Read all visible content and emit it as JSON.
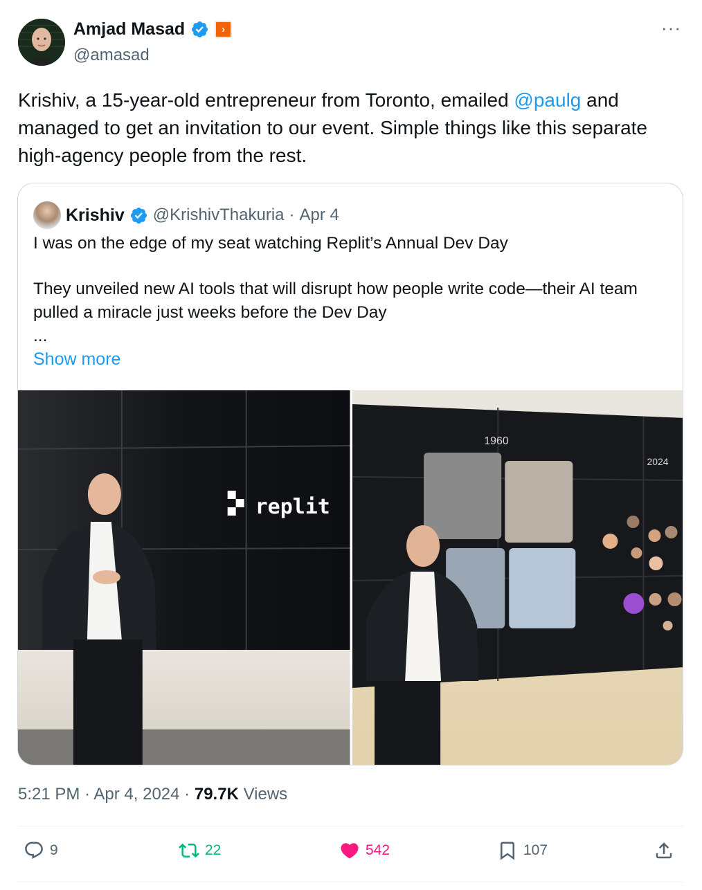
{
  "author": {
    "display_name": "Amjad Masad",
    "handle": "@amasad"
  },
  "more_label": "···",
  "tweet": {
    "text_before": "Krishiv, a 15-year-old entrepreneur from Toronto, emailed ",
    "mention": "@paulg",
    "text_after": " and managed to get an invitation to our event. Simple things like this separate high-agency people from the rest."
  },
  "quoted": {
    "display_name": "Krishiv",
    "handle": "@KrishivThakuria",
    "separator": "·",
    "date": "Apr 4",
    "line1": "I was on the edge of my seat watching Replit’s Annual Dev Day",
    "line2": "They unveiled new AI tools that will disrupt how people write code—their AI team pulled a miracle just weeks before the Dev Day",
    "ellipsis": "...",
    "show_more": "Show more",
    "photo1_screen_text": "replit",
    "photo2_label_start": "1960",
    "photo2_label_end": "2024"
  },
  "meta": {
    "time": "5:21 PM",
    "date": "Apr 4, 2024",
    "separator": "·",
    "views_count": "79.7K",
    "views_label": "Views"
  },
  "actions": {
    "replies": "9",
    "reposts": "22",
    "likes": "542",
    "bookmarks": "107"
  },
  "colors": {
    "accent": "#1d9bf0",
    "repost": "#00ba7c",
    "like": "#f91880",
    "muted": "#536471",
    "brand_badge": "#f26207"
  }
}
